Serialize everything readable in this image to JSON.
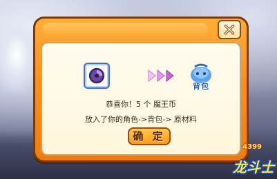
{
  "dialog": {
    "close_icon": "close-x-icon",
    "item_icon": "purple-orb-item-icon",
    "arrow_icon": "triple-arrow-icon",
    "bag": {
      "icon": "backpack-icon",
      "label": "背包"
    },
    "message_line1": "恭喜你！5 个 魔王币",
    "message_line2": "放入了你的角色->背包-> 原材料",
    "confirm_label": "确 定"
  },
  "logo": {
    "number": "4399",
    "title": "龙斗士"
  },
  "colors": {
    "frame": "#ff8f1a",
    "panel": "#fff7dc",
    "item_border": "#3f6fd8",
    "bag_text": "#1e67c7"
  }
}
